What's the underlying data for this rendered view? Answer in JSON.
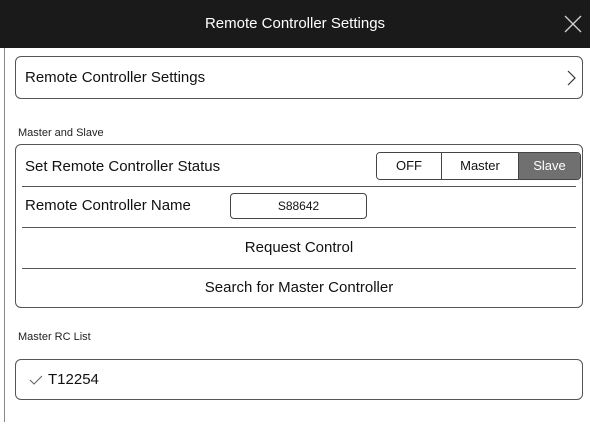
{
  "window": {
    "title": "Remote Controller Settings",
    "close_icon": "close-icon"
  },
  "settings_row": {
    "label": "Remote Controller Settings",
    "icon": "chevron-right-icon"
  },
  "master_slave": {
    "section_label": "Master and Slave",
    "status_label": "Set Remote Controller Status",
    "status_options": [
      "OFF",
      "Master",
      "Slave"
    ],
    "status_selected": "Slave",
    "name_label": "Remote Controller Name",
    "name_value": "S88642",
    "request_control": "Request Control",
    "search_master": "Search for Master Controller"
  },
  "master_list": {
    "section_label": "Master RC List",
    "items": [
      {
        "label": "T12254",
        "icon": "check-icon"
      }
    ]
  },
  "colors": {
    "titlebar": "#1a1a1a",
    "selected_segment": "#707070",
    "border": "#555555"
  }
}
